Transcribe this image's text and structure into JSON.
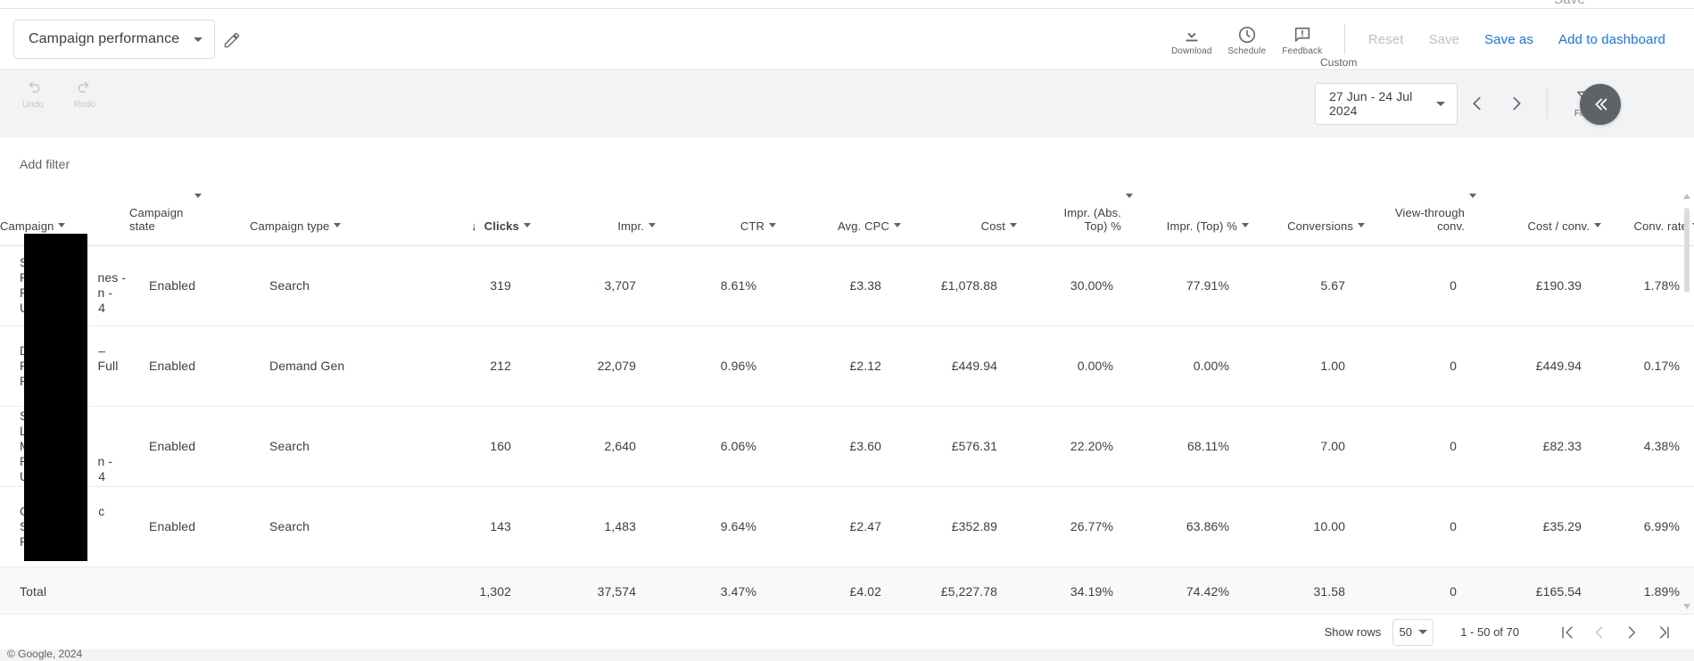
{
  "top_cut": {
    "save_label": "Save"
  },
  "header": {
    "report_name": "Campaign performance",
    "edit_icon": "pencil-icon",
    "tools": [
      {
        "icon": "download-icon",
        "label": "Download"
      },
      {
        "icon": "schedule-clock-icon",
        "label": "Schedule"
      },
      {
        "icon": "feedback-icon",
        "label": "Feedback"
      }
    ],
    "reset_label": "Reset",
    "save_label": "Save",
    "save_as_label": "Save as",
    "add_to_dashboard_label": "Add to dashboard"
  },
  "subbar": {
    "undo_label": "Undo",
    "redo_label": "Redo",
    "date_float_label": "Custom",
    "date_range": "27 Jun - 24 Jul 2024",
    "prev_arrow": "chevron-left-icon",
    "next_arrow": "chevron-right-icon",
    "filter_label": "Filter",
    "collapse_label": "«"
  },
  "filterbar": {
    "add_filter_label": "Add filter"
  },
  "table": {
    "columns": [
      {
        "key": "campaign",
        "label": "Campaign",
        "align": "left",
        "sorted": false
      },
      {
        "key": "state",
        "label": "Campaign state",
        "align": "left",
        "sorted": false
      },
      {
        "key": "type",
        "label": "Campaign type",
        "align": "left",
        "sorted": false
      },
      {
        "key": "clicks",
        "label": "Clicks",
        "align": "right",
        "sorted": true
      },
      {
        "key": "impr",
        "label": "Impr.",
        "align": "right",
        "sorted": false
      },
      {
        "key": "ctr",
        "label": "CTR",
        "align": "right",
        "sorted": false
      },
      {
        "key": "avgcpc",
        "label": "Avg. CPC",
        "align": "right",
        "sorted": false
      },
      {
        "key": "cost",
        "label": "Cost",
        "align": "right",
        "sorted": false
      },
      {
        "key": "imprabstop",
        "label": "Impr. (Abs. Top) %",
        "align": "right",
        "sorted": false
      },
      {
        "key": "imprtop",
        "label": "Impr. (Top) %",
        "align": "right",
        "sorted": false
      },
      {
        "key": "conv",
        "label": "Conversions",
        "align": "right",
        "sorted": false
      },
      {
        "key": "vtconv",
        "label": "View-through conv.",
        "align": "right",
        "sorted": false
      },
      {
        "key": "costconv",
        "label": "Cost / conv.",
        "align": "right",
        "sorted": false
      },
      {
        "key": "convrate",
        "label": "Conv. rate",
        "align": "right",
        "sorted": false
      }
    ],
    "sort_indicator": "↓",
    "rows": [
      {
        "campaign": "S███████\nP███████mes -\nP██████n -\nU█████4",
        "campaign_lines": [
          "S",
          "P",
          "P",
          "U"
        ],
        "campaign_tail": [
          "",
          "nes -",
          "n -",
          "4"
        ],
        "state": "Enabled",
        "type": "Search",
        "clicks": "319",
        "impr": "3,707",
        "ctr": "8.61%",
        "avgcpc": "£3.38",
        "cost": "£1,078.88",
        "imprabstop": "30.00%",
        "imprtop": "77.91%",
        "conv": "5.67",
        "vtconv": "0",
        "costconv": "£190.39",
        "convrate": "1.78%"
      },
      {
        "campaign_lines": [
          "D",
          "P",
          "P"
        ],
        "campaign_tail": [
          "–",
          "Full",
          ""
        ],
        "state": "Enabled",
        "type": "Demand Gen",
        "clicks": "212",
        "impr": "22,079",
        "ctr": "0.96%",
        "avgcpc": "£2.12",
        "cost": "£449.94",
        "imprabstop": "0.00%",
        "imprtop": "0.00%",
        "conv": "1.00",
        "vtconv": "0",
        "costconv": "£449.94",
        "convrate": "0.17%"
      },
      {
        "campaign_lines": [
          "S",
          "L",
          "M",
          "P",
          "U"
        ],
        "campaign_tail": [
          "",
          "",
          "",
          "n -",
          "4"
        ],
        "state": "Enabled",
        "type": "Search",
        "clicks": "160",
        "impr": "2,640",
        "ctr": "6.06%",
        "avgcpc": "£3.60",
        "cost": "£576.31",
        "imprabstop": "22.20%",
        "imprtop": "68.11%",
        "conv": "7.00",
        "vtconv": "0",
        "costconv": "£82.33",
        "convrate": "4.38%"
      },
      {
        "campaign_lines": [
          "C",
          "S",
          "P"
        ],
        "campaign_tail": [
          "c",
          "",
          ""
        ],
        "state": "Enabled",
        "type": "Search",
        "clicks": "143",
        "impr": "1,483",
        "ctr": "9.64%",
        "avgcpc": "£2.47",
        "cost": "£352.89",
        "imprabstop": "26.77%",
        "imprtop": "63.86%",
        "conv": "10.00",
        "vtconv": "0",
        "costconv": "£35.29",
        "convrate": "6.99%"
      }
    ],
    "total": {
      "label": "Total",
      "state": "",
      "type": "",
      "clicks": "1,302",
      "impr": "37,574",
      "ctr": "3.47%",
      "avgcpc": "£4.02",
      "cost": "£5,227.78",
      "imprabstop": "34.19%",
      "imprtop": "74.42%",
      "conv": "31.58",
      "vtconv": "0",
      "costconv": "£165.54",
      "convrate": "1.89%"
    }
  },
  "pager": {
    "show_rows_label": "Show rows",
    "rows_per_page": "50",
    "range_label": "1 - 50 of 70",
    "first_icon": "first-page-icon",
    "prev_icon": "prev-page-icon",
    "next_icon": "next-page-icon",
    "last_icon": "last-page-icon"
  },
  "footer": {
    "copyright": "© Google, 2024"
  },
  "colors": {
    "accent_blue": "#1a73e8",
    "text_primary": "#3c4043",
    "text_secondary": "#5f6368",
    "disabled": "#bdc1c6",
    "surface": "#ffffff",
    "background": "#f1f3f4",
    "total_row_bg": "#f8f9fa",
    "fab_grey": "#5f6368"
  }
}
